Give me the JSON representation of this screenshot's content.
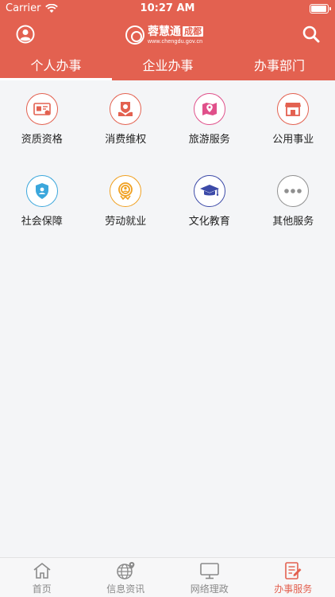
{
  "status": {
    "carrier": "Carrier",
    "time": "10:27 AM"
  },
  "header": {
    "logo_main": "蓉慧通",
    "logo_city": "成都",
    "logo_url": "www.chengdu.gov.cn"
  },
  "tabs": [
    {
      "label": "个人办事",
      "active": true
    },
    {
      "label": "企业办事",
      "active": false
    },
    {
      "label": "办事部门",
      "active": false
    }
  ],
  "services": [
    {
      "label": "资质资格",
      "icon": "certificate-icon",
      "color": "#e36150"
    },
    {
      "label": "消费维权",
      "icon": "consumer-rights-icon",
      "color": "#e36150"
    },
    {
      "label": "旅游服务",
      "icon": "map-icon",
      "color": "#e0508a"
    },
    {
      "label": "公用事业",
      "icon": "storefront-icon",
      "color": "#e36150"
    },
    {
      "label": "社会保障",
      "icon": "shield-icon",
      "color": "#3ba7dc"
    },
    {
      "label": "劳动就业",
      "icon": "employment-icon",
      "color": "#f0a020"
    },
    {
      "label": "文化教育",
      "icon": "graduation-cap-icon",
      "color": "#3c4aa8"
    },
    {
      "label": "其他服务",
      "icon": "more-icon",
      "color": "#909090"
    }
  ],
  "tabbar": [
    {
      "label": "首页",
      "icon": "home-icon",
      "active": false
    },
    {
      "label": "信息资讯",
      "icon": "globe-icon",
      "active": false
    },
    {
      "label": "网络理政",
      "icon": "monitor-icon",
      "active": false
    },
    {
      "label": "办事服务",
      "icon": "document-edit-icon",
      "active": true
    }
  ],
  "colors": {
    "accent": "#e36150",
    "background": "#f4f5f7"
  }
}
